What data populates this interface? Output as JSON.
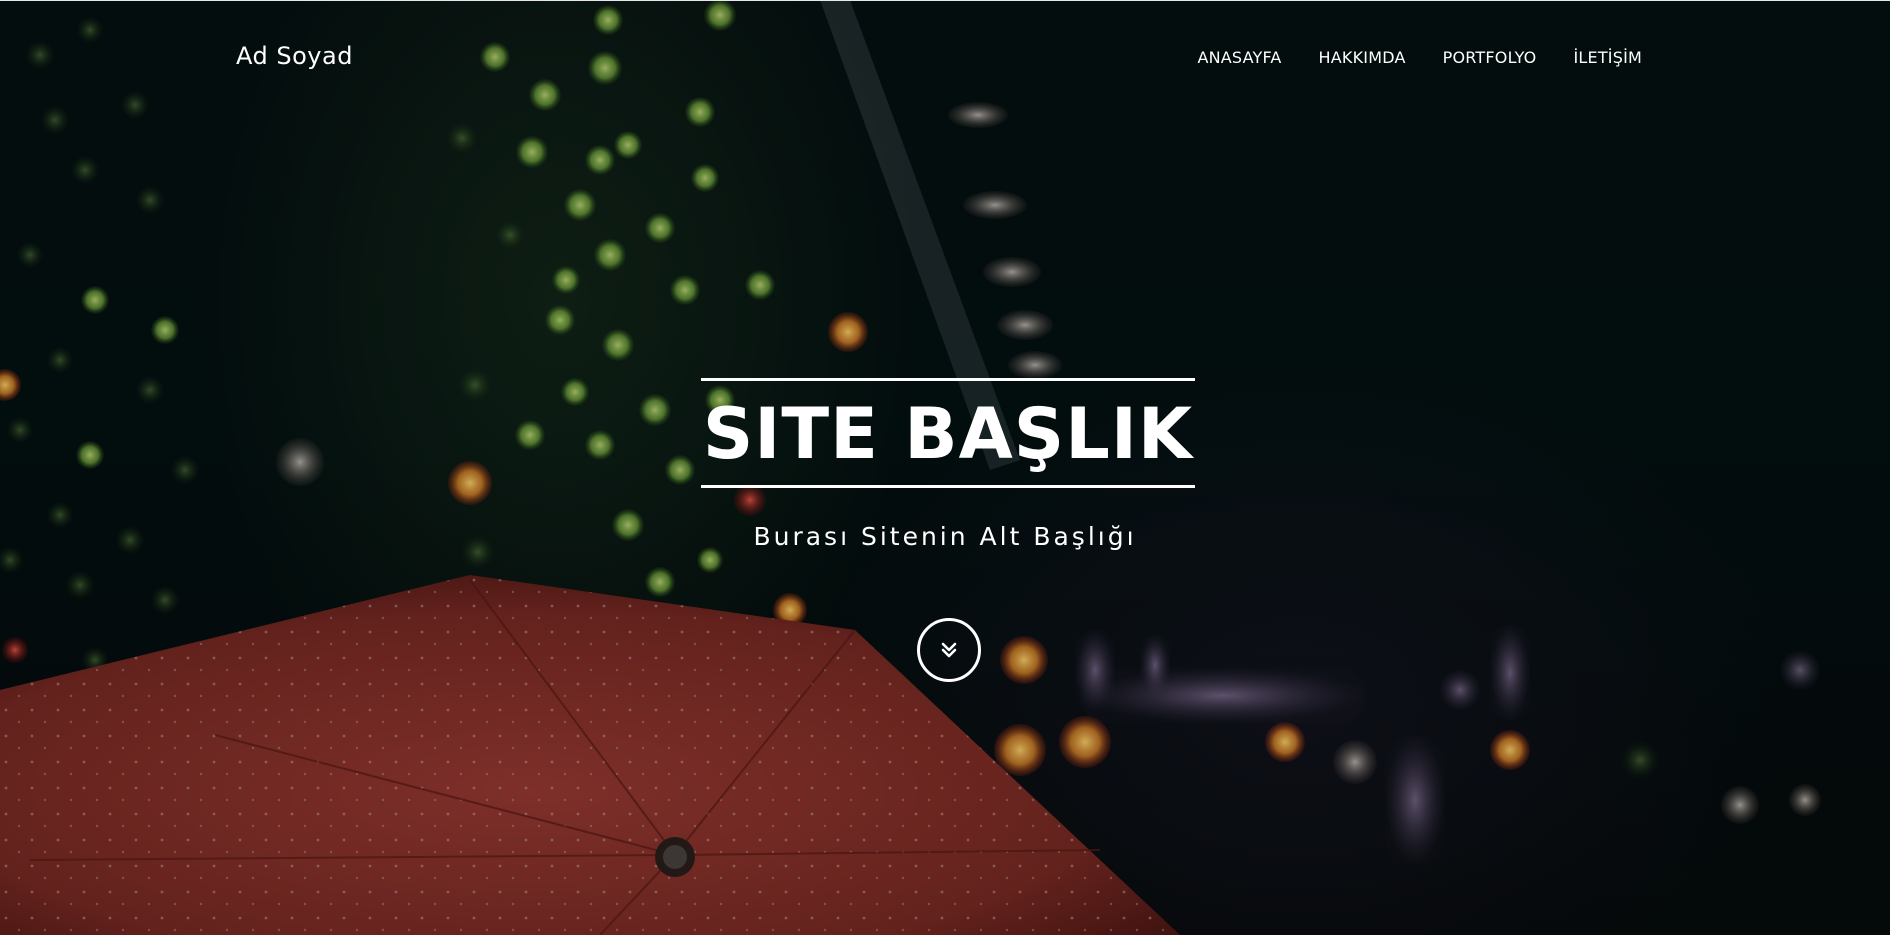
{
  "header": {
    "brand": "Ad Soyad",
    "nav": [
      {
        "label": "ANASAYFA"
      },
      {
        "label": "HAKKIMDA"
      },
      {
        "label": "PORTFOLYO"
      },
      {
        "label": "İLETİŞİM"
      }
    ]
  },
  "hero": {
    "title": "SITE BAŞLIK",
    "subtitle": "Burası Sitenin Alt Başlığı",
    "scroll_icon": "double-chevron-down-icon",
    "background_image": "red-umbrella-night-bokeh"
  },
  "colors": {
    "text": "#ffffff",
    "background": "#02090b",
    "umbrella": "#8a2f2a",
    "bokeh_green": "#6fae3a"
  }
}
